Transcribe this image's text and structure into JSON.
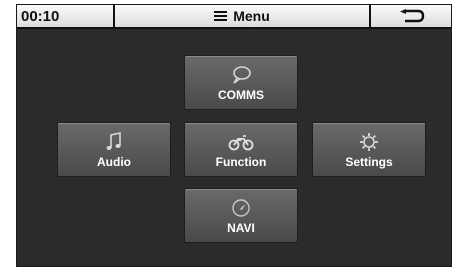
{
  "status": {
    "time": "00:10"
  },
  "header": {
    "menu_label": "Menu"
  },
  "tiles": {
    "comms": {
      "label": "COMMS",
      "icon": "speech-bubble-icon"
    },
    "audio": {
      "label": "Audio",
      "icon": "music-note-icon"
    },
    "function": {
      "label": "Function",
      "icon": "motorcycle-icon"
    },
    "settings": {
      "label": "Settings",
      "icon": "gear-icon"
    },
    "navi": {
      "label": "NAVI",
      "icon": "compass-icon"
    }
  },
  "colors": {
    "background": "#2b2b2b",
    "tile": "#5a5a5a",
    "icon": "#d8d8d8",
    "topbar": "#e8e8e8"
  }
}
